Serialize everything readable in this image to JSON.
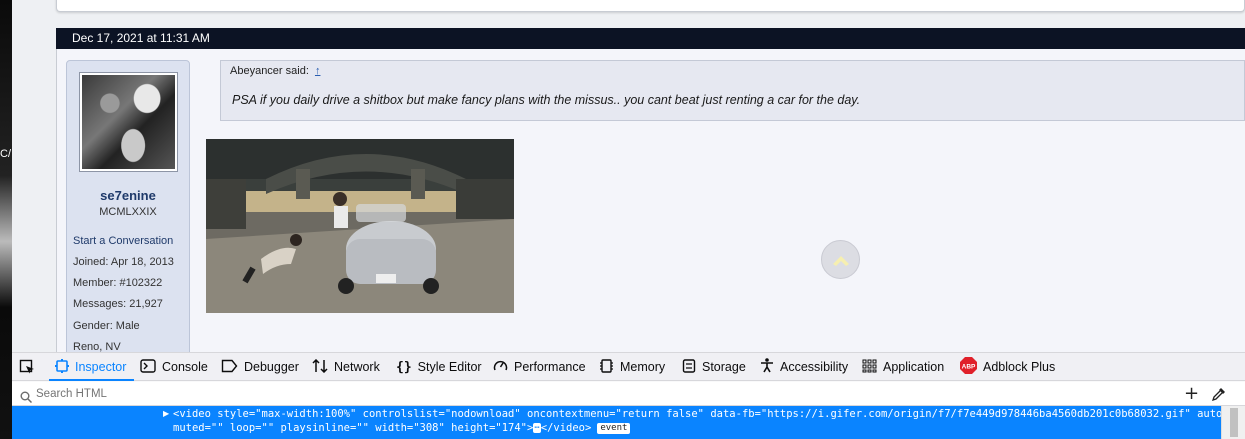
{
  "left_edge": {
    "fragment": "C/"
  },
  "post": {
    "date": "Dec 17, 2021 at 11:31 AM",
    "user": {
      "name": "se7enine",
      "title": "MCMLXXIX",
      "start_conversation": "Start a Conversation",
      "joined": "Joined: Apr 18, 2013",
      "member": "Member: #102322",
      "messages": "Messages: 21,927",
      "gender": "Gender: Male",
      "location": "Reno, NV"
    },
    "quote": {
      "author": "Abeyancer said:",
      "up_arrow": "↑",
      "text": "PSA if you daily drive a shitbox but make fancy plans with the missus.. you cant beat just renting a car for the day."
    }
  },
  "devtools": {
    "tabs": [
      {
        "label": "Inspector",
        "icon": "inspector-icon",
        "active": true
      },
      {
        "label": "Console",
        "icon": "console-icon"
      },
      {
        "label": "Debugger",
        "icon": "debugger-icon"
      },
      {
        "label": "Network",
        "icon": "network-icon"
      },
      {
        "label": "Style Editor",
        "icon": "style-editor-icon"
      },
      {
        "label": "Performance",
        "icon": "performance-icon"
      },
      {
        "label": "Memory",
        "icon": "memory-icon"
      },
      {
        "label": "Storage",
        "icon": "storage-icon"
      },
      {
        "label": "Accessibility",
        "icon": "accessibility-icon"
      },
      {
        "label": "Application",
        "icon": "application-icon"
      },
      {
        "label": "Adblock Plus",
        "icon": "abp-icon"
      }
    ],
    "search_placeholder": "Search HTML",
    "selected_node": {
      "line1": "<video style=\"max-width:100%\" controlslist=\"nodownload\" oncontextmenu=\"return false\" data-fb=\"https://i.gifer.com/origin/f7/f7e449d978446ba4560db201c0b68032.gif\" autoplay=\"\"",
      "line2": "muted=\"\" loop=\"\" playsinline=\"\" width=\"308\" height=\"174\">",
      "ellipsis": "⋯",
      "line2_tail": "</video>",
      "badge": "event"
    }
  },
  "colors": {
    "accent": "#0a84ff",
    "header_bg": "#0c1324",
    "username": "#1f3a6a"
  }
}
